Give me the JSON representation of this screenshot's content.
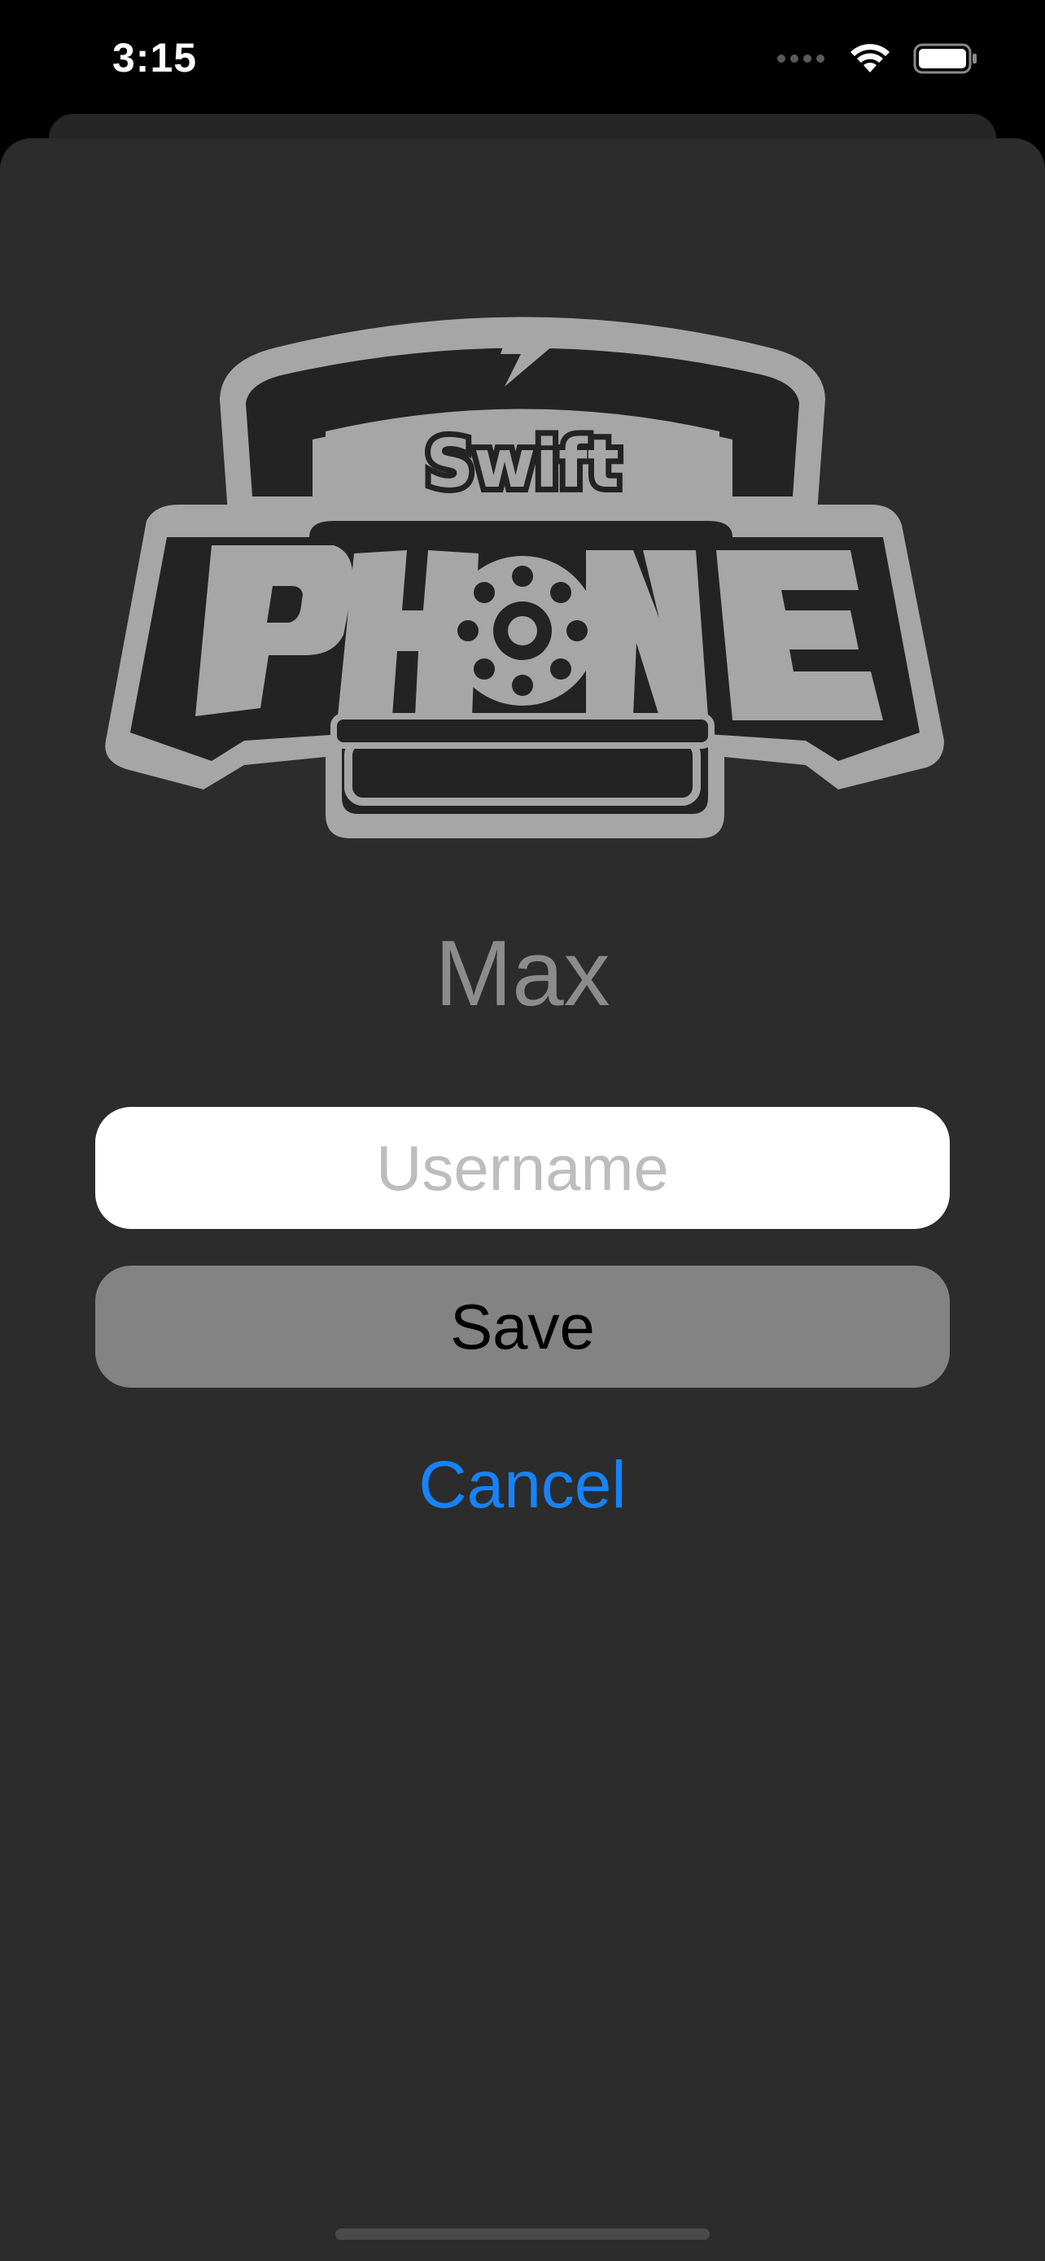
{
  "status_bar": {
    "time": "3:15",
    "icons": [
      "signal-icon",
      "wifi-icon",
      "battery-icon"
    ]
  },
  "logo": {
    "top_text": "Swift",
    "main_text": "PHONE",
    "icon": "telephone-logo-icon"
  },
  "profile": {
    "display_name": "Max"
  },
  "form": {
    "username_placeholder": "Username",
    "username_value": "",
    "save_label": "Save",
    "cancel_label": "Cancel"
  },
  "colors": {
    "background": "#2c2c2c",
    "accent": "#1783fb",
    "save_button": "#838383",
    "name_text": "#8c8c8c"
  }
}
